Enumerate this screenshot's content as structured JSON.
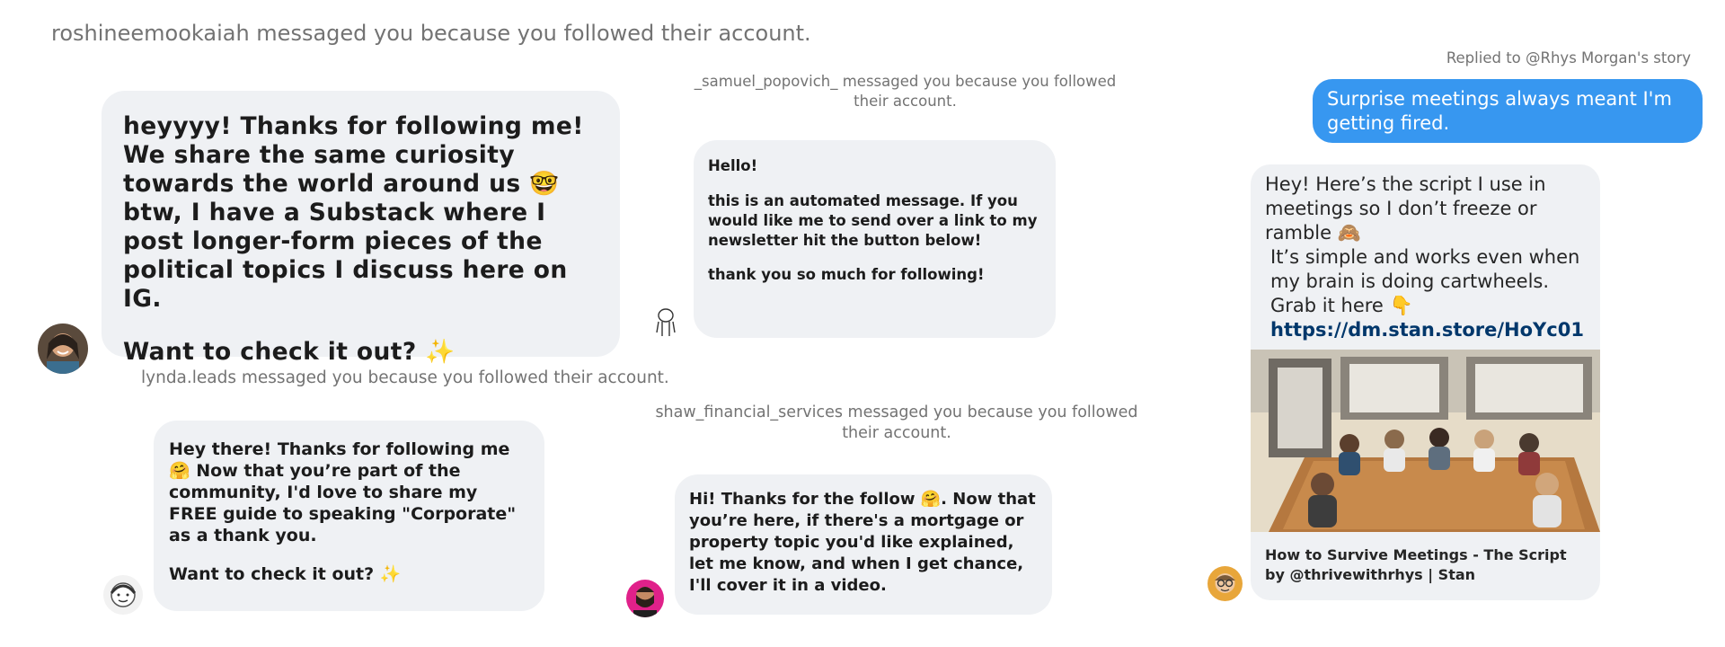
{
  "notices": {
    "roshinee": "roshineemookaiah messaged you because you followed their account.",
    "samuel": "_samuel_popovich_ messaged you because you followed their account.",
    "lynda": "lynda.leads messaged you because you followed their account.",
    "shaw": "shaw_financial_services messaged you because you followed their account."
  },
  "reply_meta": "Replied to @Rhys Morgan's story",
  "messages": {
    "roshinee": {
      "line1": "heyyyy! Thanks for following me! We share the same curiosity towards the world around us 🤓 btw, I have a Substack where I post longer-form pieces of the political topics I discuss here on IG.",
      "line2": "Want to check it out? ✨"
    },
    "samuel": {
      "line1": "Hello!",
      "line2": "this is an automated message. If you would like me to send over a link to my newsletter hit the button below!",
      "line3": "thank you so much for following!"
    },
    "lynda": {
      "line1": "Hey there! Thanks for following me 🤗 Now that you’re part of the community, I'd love to share my FREE guide to speaking \"Corporate\" as a thank you.",
      "line2": "Want to check it out? ✨"
    },
    "shaw": {
      "line1": "Hi! Thanks for the follow 🤗. Now that you’re here, if there's a mortgage or property topic you'd like explained, let me know, and when I get chance, I'll cover it in a video."
    },
    "sent": {
      "text": "Surprise meetings always meant I'm getting fired."
    },
    "rhys": {
      "line1": "Hey! Here’s the script I use in meetings so I don’t freeze or ramble 🙈",
      "line2": "It’s simple and works even when my brain is doing cartwheels.",
      "line3": "Grab it here 👇",
      "link": "https://dm.stan.store/HoYc01",
      "card_title": "How to Survive Meetings - The Script by @thrivewithrhys | Stan"
    }
  },
  "colors": {
    "sent_bubble": "#3797f0",
    "received_bubble": "#eff1f4",
    "link": "#00376b",
    "notice_text": "#737373"
  },
  "icons": {
    "avatar_roshinee": "woman-portrait-avatar",
    "avatar_samuel": "line-drawing-figure-avatar",
    "avatar_lynda": "sketch-face-avatar",
    "avatar_shaw": "bearded-man-avatar",
    "avatar_rhys": "man-with-glasses-avatar"
  }
}
